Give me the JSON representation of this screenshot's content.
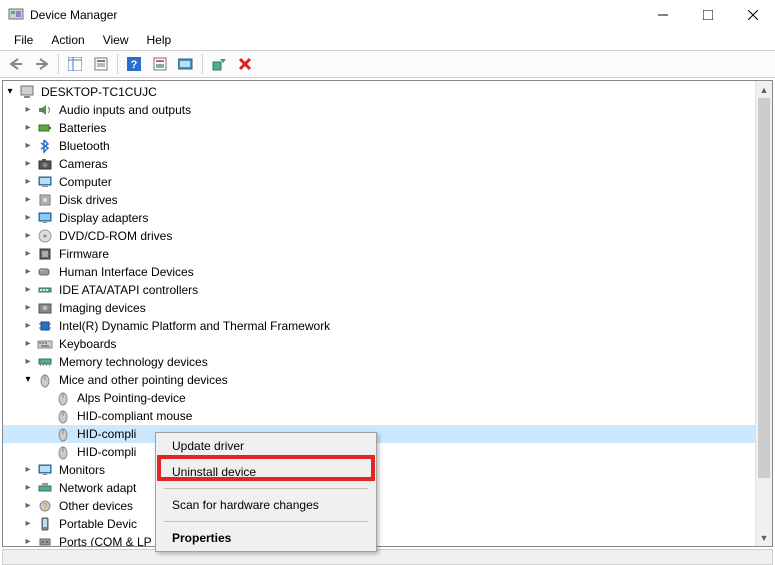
{
  "window": {
    "title": "Device Manager"
  },
  "menubar": {
    "file": "File",
    "action": "Action",
    "view": "View",
    "help": "Help"
  },
  "tree": {
    "root": "DESKTOP-TC1CUJC",
    "categories": [
      {
        "label": "Audio inputs and outputs",
        "icon": "speaker"
      },
      {
        "label": "Batteries",
        "icon": "battery"
      },
      {
        "label": "Bluetooth",
        "icon": "bluetooth"
      },
      {
        "label": "Cameras",
        "icon": "camera"
      },
      {
        "label": "Computer",
        "icon": "computer"
      },
      {
        "label": "Disk drives",
        "icon": "disk"
      },
      {
        "label": "Display adapters",
        "icon": "display"
      },
      {
        "label": "DVD/CD-ROM drives",
        "icon": "optical"
      },
      {
        "label": "Firmware",
        "icon": "firmware"
      },
      {
        "label": "Human Interface Devices",
        "icon": "hid"
      },
      {
        "label": "IDE ATA/ATAPI controllers",
        "icon": "ide"
      },
      {
        "label": "Imaging devices",
        "icon": "imaging"
      },
      {
        "label": "Intel(R) Dynamic Platform and Thermal Framework",
        "icon": "chip"
      },
      {
        "label": "Keyboards",
        "icon": "keyboard"
      },
      {
        "label": "Memory technology devices",
        "icon": "memory"
      },
      {
        "label": "Mice and other pointing devices",
        "icon": "mouse",
        "expanded": true
      },
      {
        "label": "Monitors",
        "icon": "monitor"
      },
      {
        "label": "Network adapt",
        "icon": "network",
        "truncated": true
      },
      {
        "label": "Other devices",
        "icon": "other"
      },
      {
        "label": "Portable Devic",
        "icon": "portable",
        "truncated": true
      },
      {
        "label": "Ports (COM & LP",
        "icon": "port",
        "truncated": true
      }
    ],
    "mice_children": [
      {
        "label": "Alps Pointing-device"
      },
      {
        "label": "HID-compliant mouse"
      },
      {
        "label": "HID-compli",
        "selected": true
      },
      {
        "label": "HID-compli"
      }
    ]
  },
  "context_menu": {
    "update": "Update driver",
    "uninstall": "Uninstall device",
    "scan": "Scan for hardware changes",
    "properties": "Properties"
  }
}
